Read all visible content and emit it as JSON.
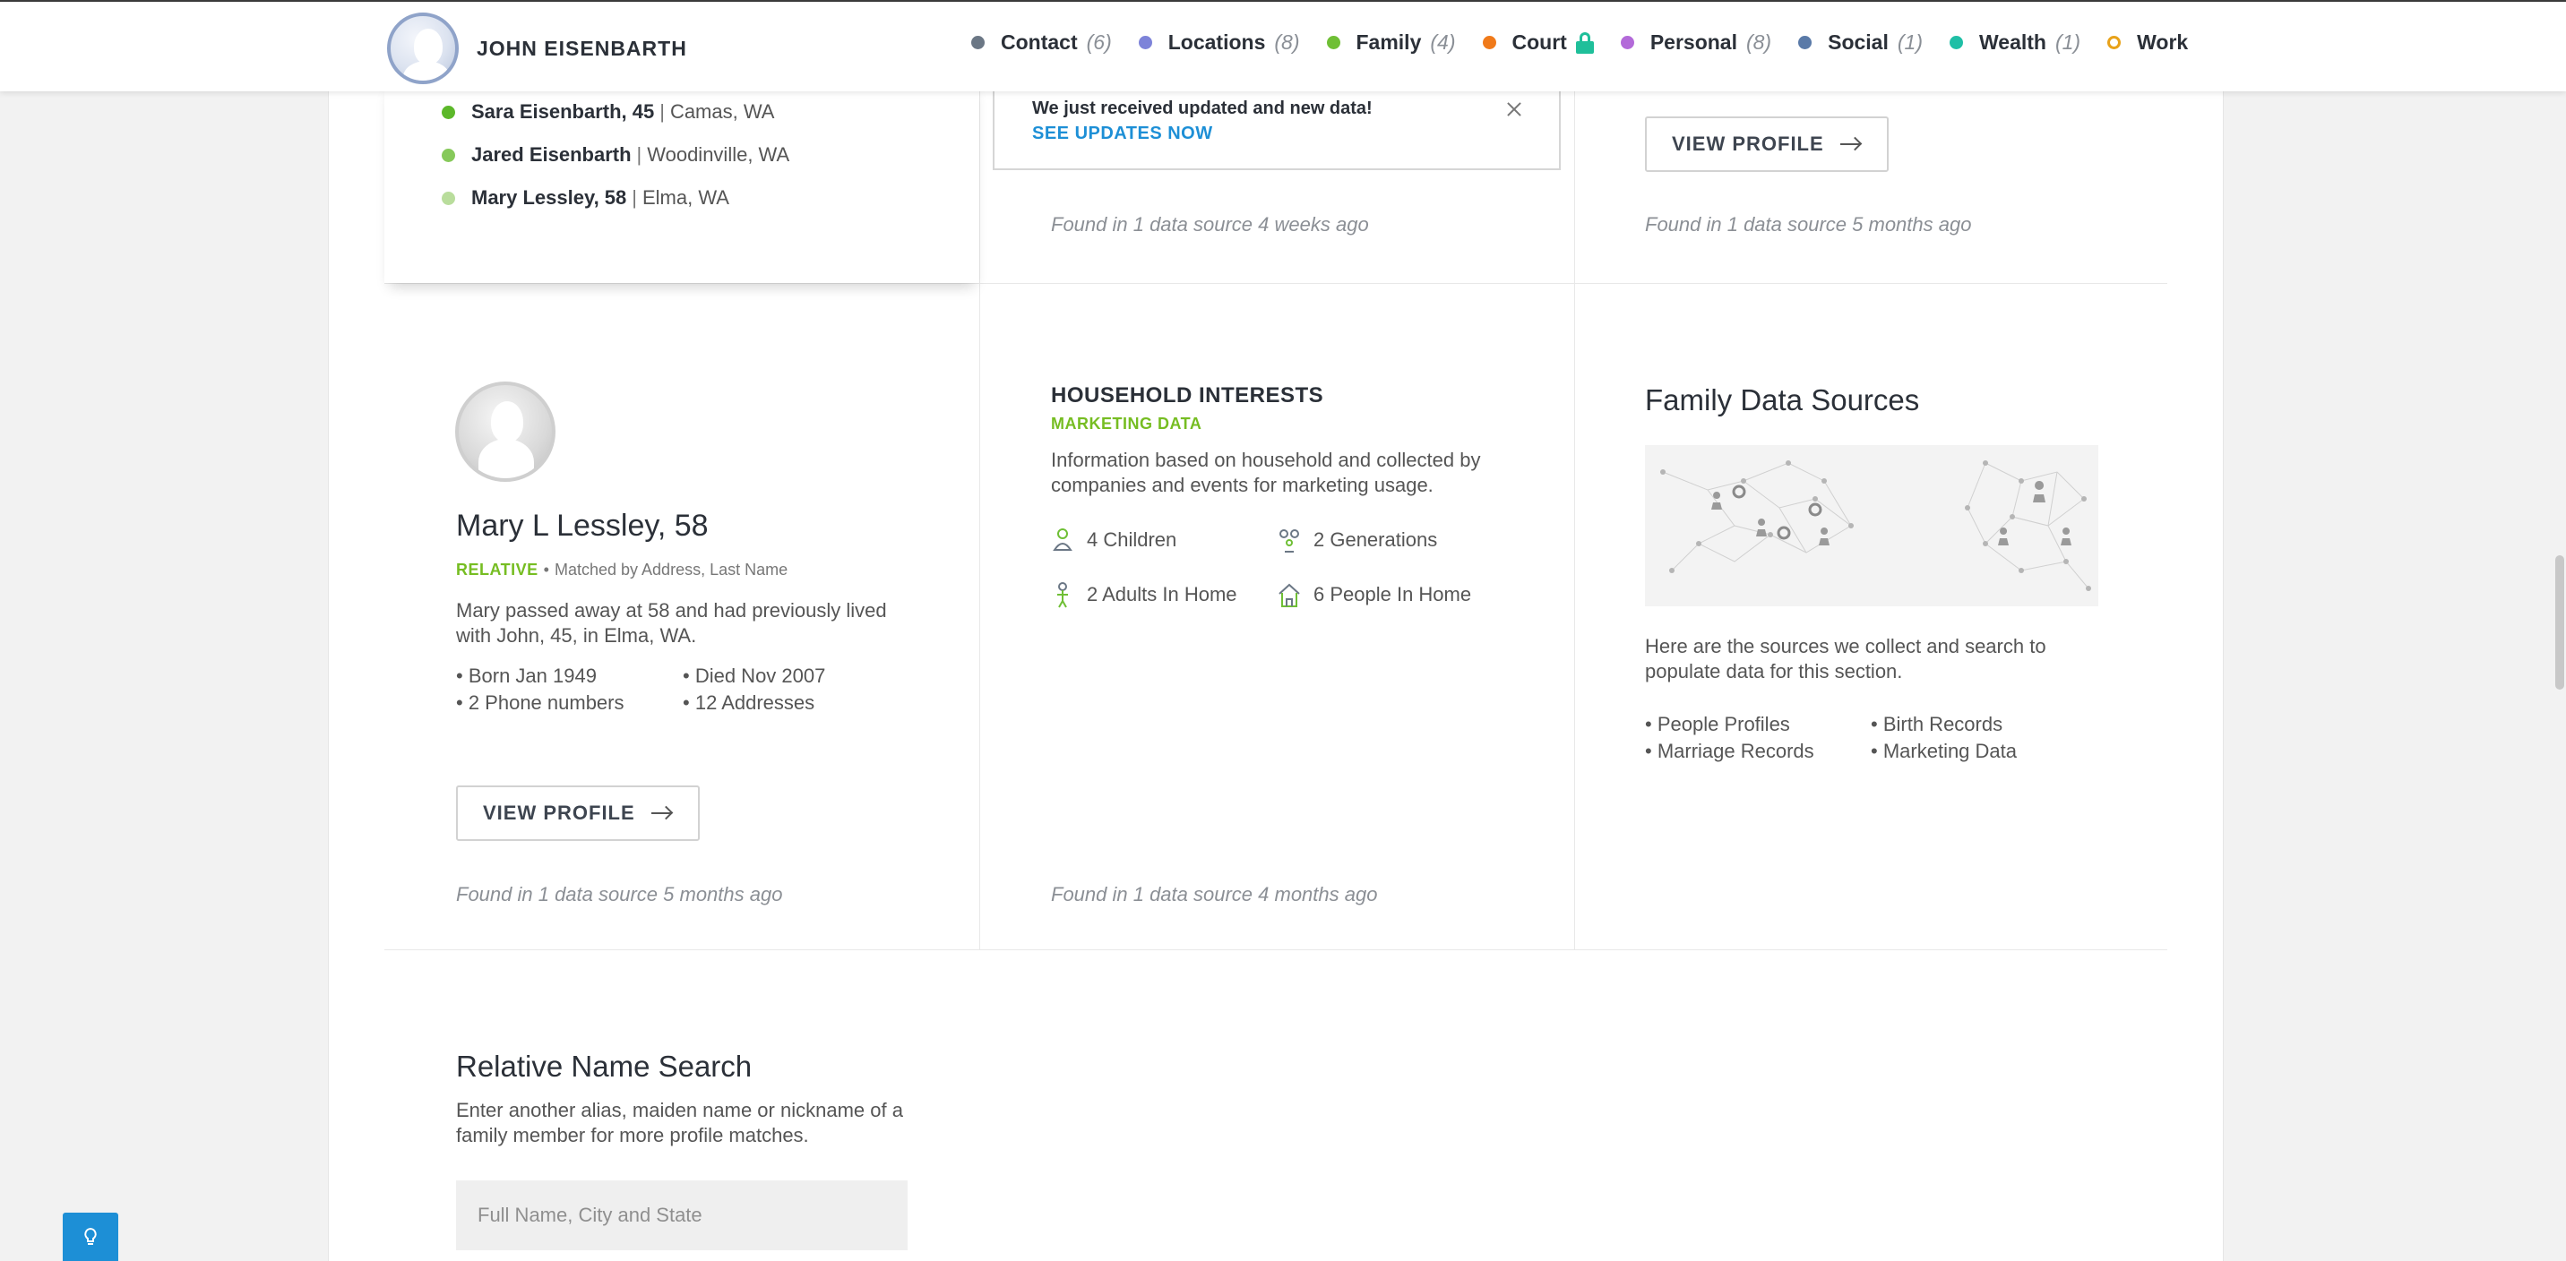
{
  "header": {
    "brand_name": "JOHN EISENBARTH",
    "nav": [
      {
        "label": "Contact",
        "count": "(6)",
        "color": "#6b7785"
      },
      {
        "label": "Locations",
        "count": "(8)",
        "color": "#7d83d9"
      },
      {
        "label": "Family",
        "count": "(4)",
        "color": "#6fbf35"
      },
      {
        "label": "Court",
        "count": "",
        "color": "#f07a1a",
        "locked": true
      },
      {
        "label": "Personal",
        "count": "(8)",
        "color": "#b36ad9"
      },
      {
        "label": "Social",
        "count": "(1)",
        "color": "#5a7aa8"
      },
      {
        "label": "Wealth",
        "count": "(1)",
        "color": "#1fbfa6"
      },
      {
        "label": "Work",
        "count": "",
        "color": "#e8a21a"
      }
    ]
  },
  "notification": {
    "message": "We just received updated and new data!",
    "link": "SEE UPDATES NOW"
  },
  "family_list": [
    {
      "name": "Sara Eisenbarth, 45",
      "location": "Camas, WA",
      "dot": "#5cb82a"
    },
    {
      "name": "Jared Eisenbarth",
      "location": "Woodinville, WA",
      "dot": "#86c95a"
    },
    {
      "name": "Mary Lessley, 58",
      "location": "Elma, WA",
      "dot": "#b9dd9c"
    }
  ],
  "top_row": {
    "middle_found": "Found in 1 data source 4 weeks ago",
    "right_button": "VIEW PROFILE",
    "right_found": "Found in 1 data source 5 months ago"
  },
  "relative": {
    "name": "Mary L Lessley, 58",
    "tag": "RELATIVE",
    "separator": "•",
    "match": "Matched by Address, Last Name",
    "description": "Mary passed away at 58 and had previously lived with John, 45, in Elma, WA.",
    "facts": [
      "Born Jan 1949",
      "Died Nov 2007",
      "2 Phone numbers",
      "12 Addresses"
    ],
    "button": "VIEW PROFILE",
    "found": "Found in 1 data source 5 months ago"
  },
  "household": {
    "title": "HOUSEHOLD INTERESTS",
    "subtitle": "MARKETING DATA",
    "description": "Information based on household and collected by companies and events for marketing usage.",
    "items": [
      {
        "label": "4 Children",
        "icon": "children-icon"
      },
      {
        "label": "2 Generations",
        "icon": "generations-icon"
      },
      {
        "label": "2 Adults In Home",
        "icon": "adult-icon"
      },
      {
        "label": "6 People In Home",
        "icon": "home-people-icon"
      }
    ],
    "found": "Found in 1 data source 4 months ago"
  },
  "sources": {
    "title": "Family Data Sources",
    "description": "Here are the sources we collect and search to populate data for this section.",
    "items": [
      "People Profiles",
      "Birth Records",
      "Marriage Records",
      "Marketing Data"
    ]
  },
  "relative_search": {
    "title": "Relative Name Search",
    "description": "Enter another alias, maiden name or nickname of a family member for more profile matches.",
    "placeholder": "Full Name, City and State"
  }
}
